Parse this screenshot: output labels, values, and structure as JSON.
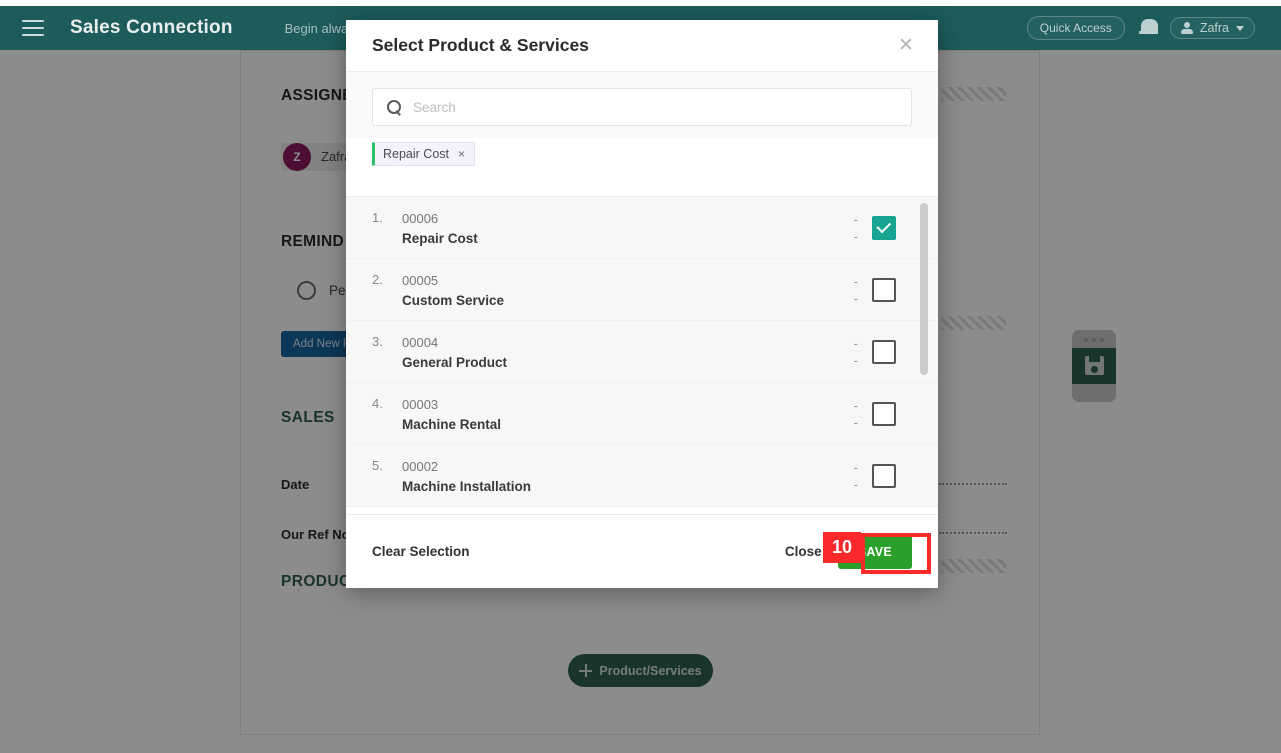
{
  "appbar": {
    "menu_icon": "hamburger-icon",
    "brand": "Sales Connection",
    "tagline": "Begin always",
    "quick_access": "Quick Access",
    "bell_icon": "bell-icon",
    "user_name": "Zafra"
  },
  "background": {
    "assignee_heading": "ASSIGNE",
    "assignee_avatar_initial": "Z",
    "assignee_name": "Zafra",
    "reminder_heading": "REMIND",
    "reminder_option": "Per",
    "add_reminder_button": "Add New R",
    "sales_heading": "SALES",
    "field_date": "Date",
    "field_our_ref_no": "Our Ref No",
    "product_heading": "PRODUC",
    "add_product_button": "Product/Services",
    "save_widget_icon": "floppy-disk-icon"
  },
  "modal": {
    "title": "Select Product & Services",
    "close_icon": "close-icon",
    "search": {
      "icon": "search-icon",
      "placeholder": "Search",
      "value": ""
    },
    "selected_chips": [
      {
        "label": "Repair Cost",
        "remove_icon": "×"
      }
    ],
    "rows": [
      {
        "index": "1.",
        "code": "00006",
        "name": "Repair Cost",
        "col1": "-",
        "col2": "-",
        "checked": true
      },
      {
        "index": "2.",
        "code": "00005",
        "name": "Custom Service",
        "col1": "-",
        "col2": "-",
        "checked": false
      },
      {
        "index": "3.",
        "code": "00004",
        "name": "General Product",
        "col1": "-",
        "col2": "-",
        "checked": false
      },
      {
        "index": "4.",
        "code": "00003",
        "name": "Machine Rental",
        "col1": "-",
        "col2": "-",
        "checked": false
      },
      {
        "index": "5.",
        "code": "00002",
        "name": "Machine Installation",
        "col1": "-",
        "col2": "-",
        "checked": false
      }
    ],
    "footer": {
      "clear_selection": "Clear Selection",
      "close": "Close",
      "save": "SAVE"
    }
  },
  "annotation": {
    "step_number": "10",
    "color": "#fa2a2a"
  },
  "colors": {
    "appbar": "#1e5b5b",
    "accent_green": "#2f6050",
    "checkbox_checked": "#19a391",
    "save_button": "#2aa02a",
    "chip_accent": "#2bbf6a",
    "avatar": "#8a1a5b",
    "blue_button": "#1565a0"
  }
}
